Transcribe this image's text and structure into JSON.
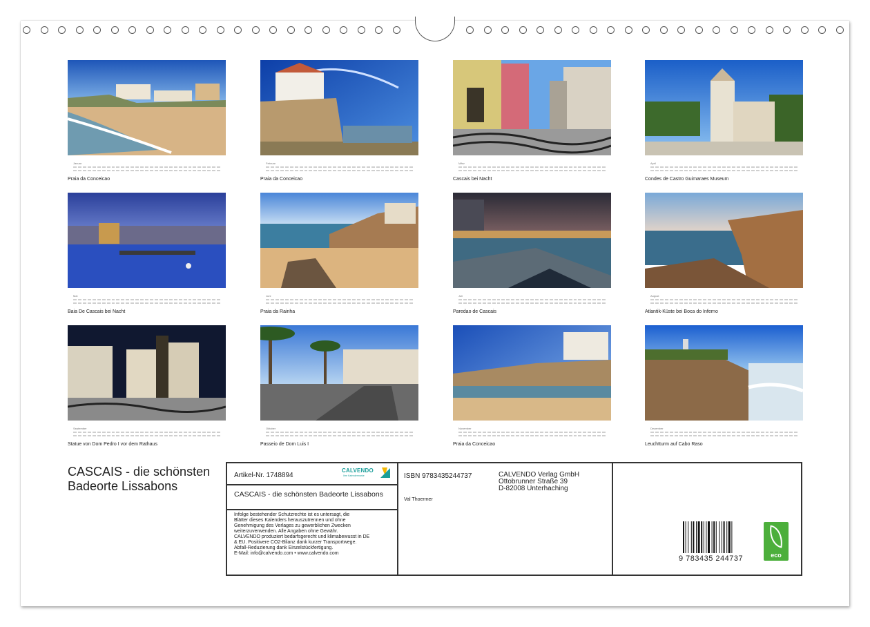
{
  "months": [
    {
      "label": "Januar",
      "caption": "Praia da Conceicao",
      "icon": "beach-photo"
    },
    {
      "label": "Februar",
      "caption": "Praia da Conceicao",
      "icon": "rock-villa-photo"
    },
    {
      "label": "März",
      "caption": "Cascais bei Nacht",
      "icon": "street-photo"
    },
    {
      "label": "April",
      "caption": "Condes de Castro Guimaraes Museum",
      "icon": "museum-photo"
    },
    {
      "label": "Mai",
      "caption": "Baia De Cascais bei Nacht",
      "icon": "bay-night-photo"
    },
    {
      "label": "Juni",
      "caption": "Praia da Rainha",
      "icon": "beach-rocks-photo"
    },
    {
      "label": "Juli",
      "caption": "Paredao de Cascais",
      "icon": "promenade-night-photo"
    },
    {
      "label": "August",
      "caption": "Atlantik-Küste bei Boca do Inferno",
      "icon": "cliffs-photo"
    },
    {
      "label": "September",
      "caption": "Statue von Dom Pedro I vor dem Rathaus",
      "icon": "statue-photo"
    },
    {
      "label": "Oktober",
      "caption": "Passeio de Dom Luis I",
      "icon": "palm-road-photo"
    },
    {
      "label": "November",
      "caption": "Praia da Conceicao",
      "icon": "coast-villa-photo"
    },
    {
      "label": "Dezember",
      "caption": "Leuchtturm auf Cabo Raso",
      "icon": "lighthouse-photo"
    }
  ],
  "title": "CASCAIS - die schönsten Badeorte Lissabons",
  "info": {
    "article": "Artikel-Nr. 1748894",
    "logo": "CALVENDO",
    "logo_sub": "Ihre Kalendermarke",
    "subtitle": "CASCAIS - die schönsten Badeorte Lissabons",
    "legal": [
      "Infolge bestehender Schutzrechte ist es untersagt, die",
      "Blätter dieses Kalenders herauszutrennen und ohne",
      "Genehmigung des Verlages zu gewerblichen Zwecken",
      "weiterzuverwenden. Alle Angaben ohne Gewähr.",
      "CALVENDO produziert bedarfsgerecht und klimabewusst in DE",
      "& EU. Positivere CO2-Bilanz dank kurzer Transportwege.",
      "Abfall-Reduzierung dank Einzelstückfertigung.",
      "E-Mail: info@calvendo.com • www.calvendo.com"
    ],
    "isbn": "ISBN 9783435244737",
    "author": "Val Thoermer",
    "publisher": [
      "CALVENDO Verlag GmbH",
      "Ottobrunner Straße 39",
      "D-82008 Unterhaching"
    ],
    "barcode_number": "9   783435   244737",
    "eco_label": "eco"
  },
  "colors": {
    "accent": "#1a9e9a",
    "eco": "#4caf3b",
    "border": "#333333"
  }
}
